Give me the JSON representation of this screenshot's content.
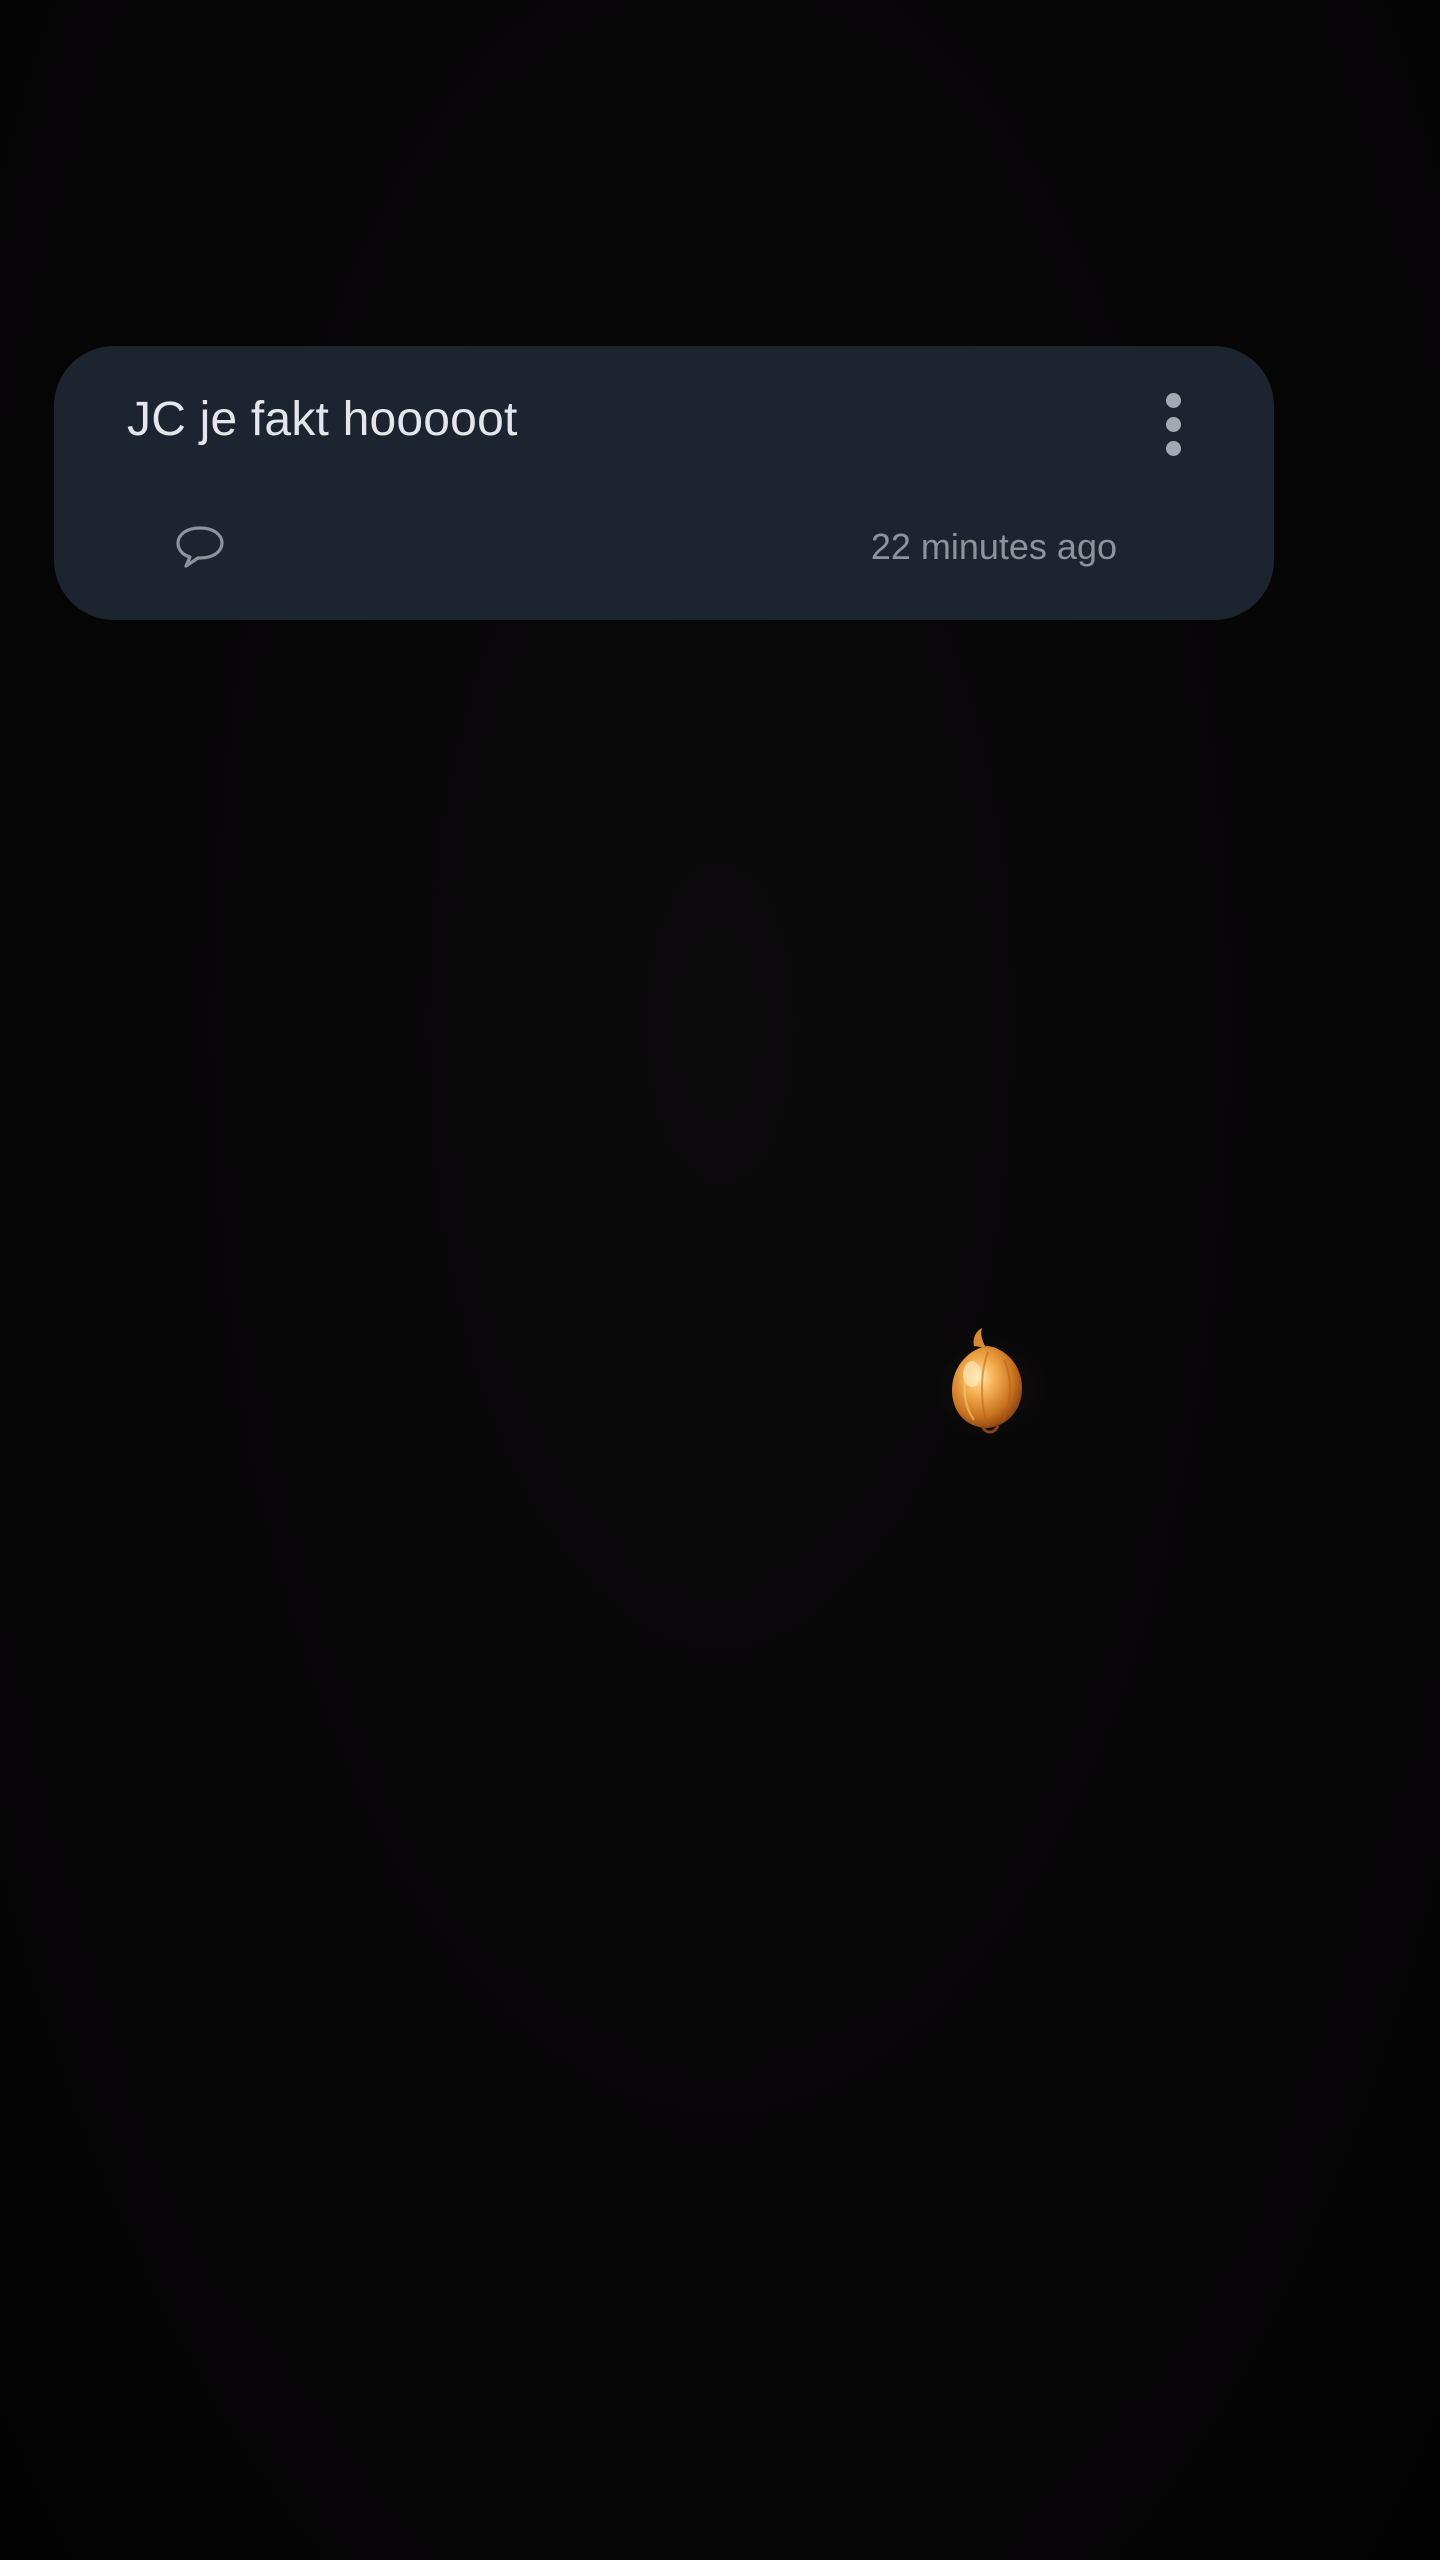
{
  "post": {
    "title": "JC je fakt hooooot",
    "timestamp": "22 minutes ago"
  },
  "icons": {
    "more": "more-vertical-icon",
    "comment": "speech-bubble-icon",
    "emoji": "onion"
  },
  "colors": {
    "background": "#060506",
    "card": "#1c2430",
    "title_text": "#e3e6ea",
    "secondary_text": "#8d939b",
    "icon": "#a3a9b1"
  }
}
